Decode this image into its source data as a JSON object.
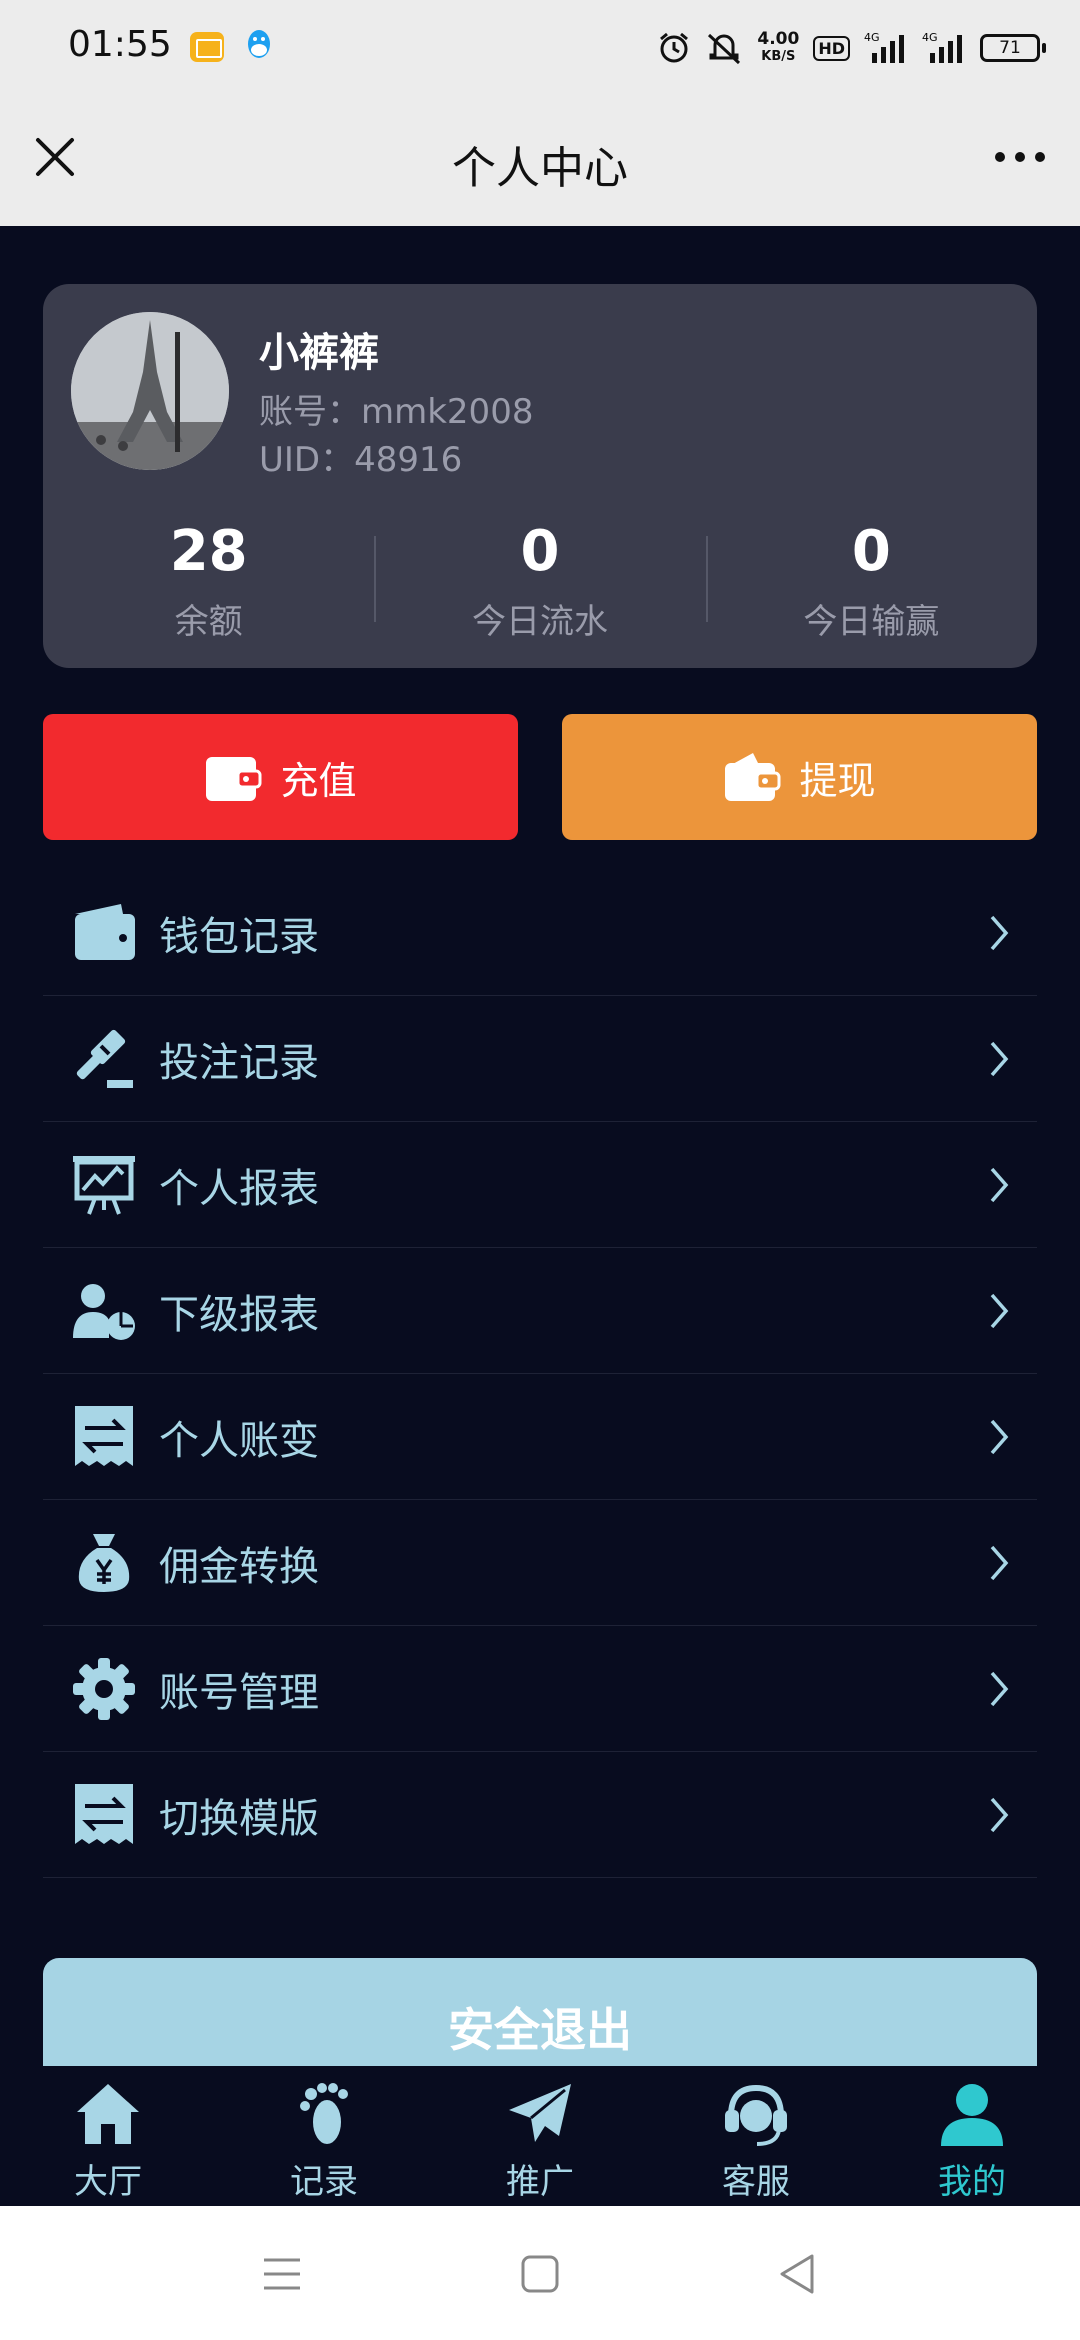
{
  "status_bar": {
    "time": "01:55",
    "speed_value": "4.00",
    "speed_unit": "KB/S",
    "hd": "HD",
    "net1": "4G",
    "net2": "4G",
    "battery": "71"
  },
  "header": {
    "title": "个人中心"
  },
  "profile": {
    "name": "小裤裤",
    "account": "账号：mmk2008",
    "uid": "UID：48916",
    "stats": [
      {
        "value": "28",
        "label": "余额"
      },
      {
        "value": "0",
        "label": "今日流水"
      },
      {
        "value": "0",
        "label": "今日输赢"
      }
    ]
  },
  "actions": {
    "recharge": "充值",
    "withdraw": "提现"
  },
  "menu": [
    {
      "label": "钱包记录",
      "icon": "wallet-icon"
    },
    {
      "label": "投注记录",
      "icon": "gavel-icon"
    },
    {
      "label": "个人报表",
      "icon": "chart-board-icon"
    },
    {
      "label": "下级报表",
      "icon": "user-pie-icon"
    },
    {
      "label": "个人账变",
      "icon": "receipt-swap-icon"
    },
    {
      "label": "佣金转换",
      "icon": "money-bag-icon"
    },
    {
      "label": "账号管理",
      "icon": "gear-icon"
    },
    {
      "label": "切换模版",
      "icon": "receipt-swap-icon"
    }
  ],
  "logout_label": "安全退出",
  "tabs": [
    {
      "label": "大厅",
      "icon": "home-icon"
    },
    {
      "label": "记录",
      "icon": "footprint-icon"
    },
    {
      "label": "推广",
      "icon": "paper-plane-icon"
    },
    {
      "label": "客服",
      "icon": "headset-icon"
    },
    {
      "label": "我的",
      "icon": "user-icon",
      "active": true
    }
  ],
  "colors": {
    "background": "#080c1f",
    "card": "#3a3c4c",
    "recharge": "#f22a2e",
    "withdraw": "#ec953b",
    "menu_text": "#a8d6e6",
    "active_tab": "#2fc8cf",
    "logout": "#a6d4e4"
  }
}
